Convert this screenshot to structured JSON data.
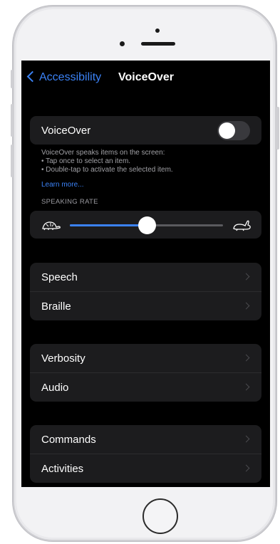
{
  "nav": {
    "back_label": "Accessibility",
    "title": "VoiceOver"
  },
  "voiceover": {
    "label": "VoiceOver",
    "enabled": false
  },
  "description": {
    "lines": [
      "VoiceOver speaks items on the screen:",
      "• Tap once to select an item.",
      "• Double-tap to activate the selected item."
    ],
    "learn_more": "Learn more..."
  },
  "speaking_rate": {
    "header": "SPEAKING RATE",
    "value_fraction": 0.5,
    "min_icon": "turtle-icon",
    "max_icon": "hare-icon"
  },
  "groups": [
    {
      "items": [
        {
          "label": "Speech"
        },
        {
          "label": "Braille"
        }
      ]
    },
    {
      "items": [
        {
          "label": "Verbosity"
        },
        {
          "label": "Audio"
        }
      ]
    },
    {
      "items": [
        {
          "label": "Commands"
        },
        {
          "label": "Activities"
        }
      ]
    }
  ],
  "colors": {
    "accent": "#3b82f6",
    "background": "#000000",
    "cell": "#1c1c1e"
  }
}
